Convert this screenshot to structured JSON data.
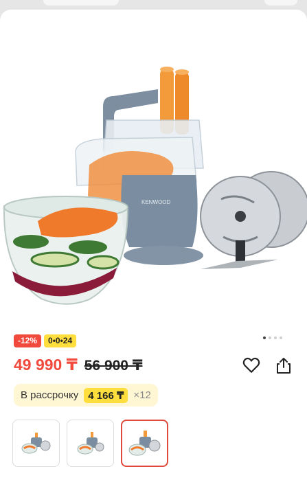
{
  "product": {
    "brand": "KENWOOD",
    "badges": {
      "discount": "-12%",
      "installment": "0•0•24"
    },
    "price": {
      "current": "49 990 ₸",
      "old": "56 900 ₸"
    },
    "installment": {
      "label": "В рассрочку",
      "amount": "4 166 ₸",
      "times": "×12"
    }
  },
  "gallery": {
    "slides": 4,
    "active_slide": 1,
    "thumbnails": 3,
    "active_thumbnail": 3
  },
  "colors": {
    "accent": "#f1493b",
    "highlight": "#ffde3d",
    "installment_bg": "#fff7d4"
  },
  "icons": {
    "favorite": "heart-icon",
    "share": "share-icon"
  }
}
